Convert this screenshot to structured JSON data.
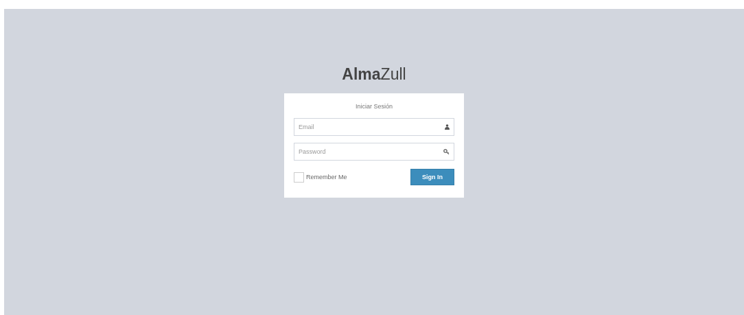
{
  "logo": "**Alma**Zull",
  "login_box": {
    "title": "Iniciar Sesión",
    "email_field": {
      "placeholder": "Email"
    },
    "password_field": {
      "placeholder": "Password"
    },
    "remember_me": {
      "label": "Remember Me",
      "checked": false
    },
    "sign_in_button": "Sign In"
  }
}
